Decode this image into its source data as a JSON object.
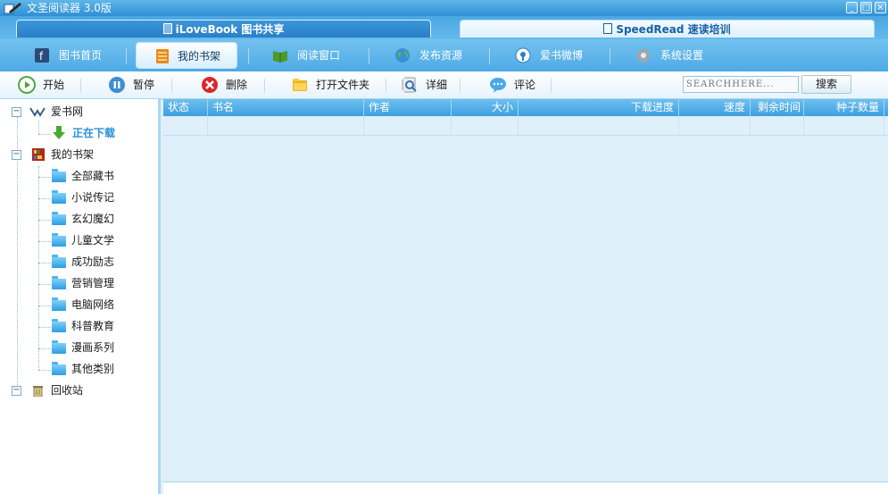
{
  "window": {
    "title": "文圣阅读器 3.0版"
  },
  "tabs": [
    {
      "label": "iLoveBook 图书共享"
    },
    {
      "label": "SpeedRead 速读培训"
    }
  ],
  "nav": [
    {
      "label": "图书首页",
      "icon": "book-home-icon"
    },
    {
      "label": "我的书架",
      "icon": "bookshelf-icon"
    },
    {
      "label": "阅读窗口",
      "icon": "open-book-icon"
    },
    {
      "label": "发布资源",
      "icon": "globe-icon"
    },
    {
      "label": "爱书微博",
      "icon": "microblog-icon"
    },
    {
      "label": "系统设置",
      "icon": "gear-icon"
    }
  ],
  "toolbar": {
    "start": "开始",
    "pause": "暂停",
    "delete": "删除",
    "open_folder": "打开文件夹",
    "detail": "详细",
    "comment": "评论",
    "search_placeholder": "SEARCHHERE...",
    "search_button": "搜索"
  },
  "tree": {
    "root1": "爱书网",
    "downloading": "正在下载",
    "root2": "我的书架",
    "folders": [
      "全部藏书",
      "小说传记",
      "玄幻魔幻",
      "儿童文学",
      "成功励志",
      "营销管理",
      "电脑网络",
      "科普教育",
      "漫画系列",
      "其他类别"
    ],
    "recycle": "回收站"
  },
  "columns": [
    "状态",
    "书名",
    "作者",
    "大小",
    "下载进度",
    "速度",
    "剩余时间",
    "种子数量"
  ],
  "colors": {
    "accent": "#3d9fe0",
    "downloading_text": "#2a8fd8"
  }
}
